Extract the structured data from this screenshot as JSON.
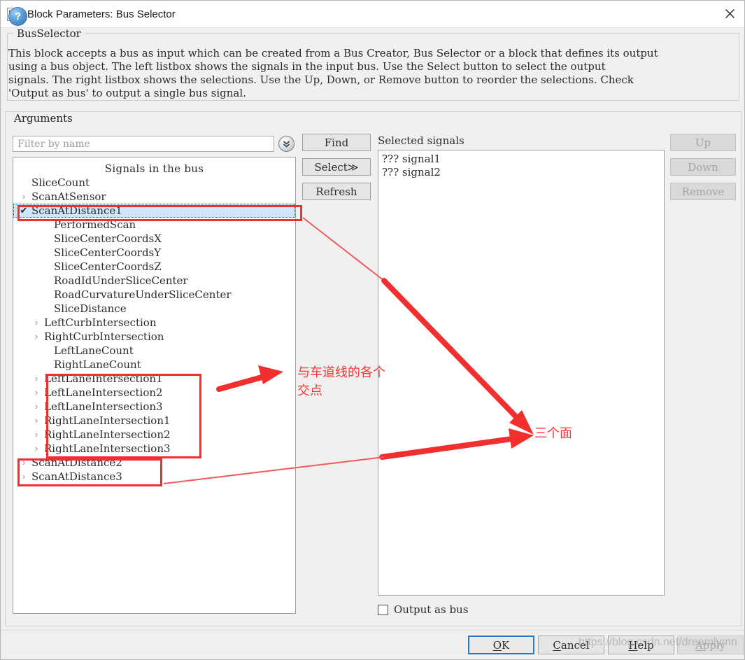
{
  "window": {
    "title": "Block Parameters: Bus Selector",
    "icon": "simulink-block-icon",
    "close_label": "✕"
  },
  "description": {
    "legend": "BusSelector",
    "text": "This block accepts a bus as input which can be created from a Bus Creator, Bus Selector or a block that defines its output\nusing a bus object. The left listbox shows the signals in the input bus. Use the Select button to select the output\nsignals. The right listbox shows the selections. Use the Up, Down, or Remove button to reorder the selections. Check\n'Output as bus' to output a single bus signal."
  },
  "arguments": {
    "legend": "Arguments",
    "filter": {
      "value": "",
      "placeholder": "Filter by name",
      "dropdown_icon": "double-chevron-down-icon"
    },
    "list_header": "Signals in the bus",
    "tree": [
      {
        "label": "SliceCount",
        "level": 0,
        "twisty": "",
        "checked": false,
        "selected": false
      },
      {
        "label": "ScanAtSensor",
        "level": 0,
        "twisty": "›",
        "checked": false,
        "selected": false
      },
      {
        "label": "ScanAtDistance1",
        "level": 0,
        "twisty": "",
        "checked": true,
        "selected": true
      },
      {
        "label": "PerformedScan",
        "level": 1,
        "twisty": "",
        "checked": false,
        "selected": false
      },
      {
        "label": "SliceCenterCoordsX",
        "level": 1,
        "twisty": "",
        "checked": false,
        "selected": false
      },
      {
        "label": "SliceCenterCoordsY",
        "level": 1,
        "twisty": "",
        "checked": false,
        "selected": false
      },
      {
        "label": "SliceCenterCoordsZ",
        "level": 1,
        "twisty": "",
        "checked": false,
        "selected": false
      },
      {
        "label": "RoadIdUnderSliceCenter",
        "level": 1,
        "twisty": "",
        "checked": false,
        "selected": false
      },
      {
        "label": "RoadCurvatureUnderSliceCenter",
        "level": 1,
        "twisty": "",
        "checked": false,
        "selected": false
      },
      {
        "label": "SliceDistance",
        "level": 1,
        "twisty": "",
        "checked": false,
        "selected": false
      },
      {
        "label": "LeftCurbIntersection",
        "level": 2,
        "twisty": "›",
        "checked": false,
        "selected": false
      },
      {
        "label": "RightCurbIntersection",
        "level": 2,
        "twisty": "›",
        "checked": false,
        "selected": false
      },
      {
        "label": "LeftLaneCount",
        "level": 1,
        "twisty": "",
        "checked": false,
        "selected": false
      },
      {
        "label": "RightLaneCount",
        "level": 1,
        "twisty": "",
        "checked": false,
        "selected": false
      },
      {
        "label": "LeftLaneIntersection1",
        "level": 2,
        "twisty": "›",
        "checked": false,
        "selected": false
      },
      {
        "label": "LeftLaneIntersection2",
        "level": 2,
        "twisty": "›",
        "checked": false,
        "selected": false
      },
      {
        "label": "LeftLaneIntersection3",
        "level": 2,
        "twisty": "›",
        "checked": false,
        "selected": false
      },
      {
        "label": "RightLaneIntersection1",
        "level": 2,
        "twisty": "›",
        "checked": false,
        "selected": false
      },
      {
        "label": "RightLaneIntersection2",
        "level": 2,
        "twisty": "›",
        "checked": false,
        "selected": false
      },
      {
        "label": "RightLaneIntersection3",
        "level": 2,
        "twisty": "›",
        "checked": false,
        "selected": false
      },
      {
        "label": "ScanAtDistance2",
        "level": 0,
        "twisty": "›",
        "checked": false,
        "selected": false
      },
      {
        "label": "ScanAtDistance3",
        "level": 0,
        "twisty": "›",
        "checked": false,
        "selected": false
      }
    ],
    "buttons": {
      "find": "Find",
      "select": "Select≫",
      "refresh": "Refresh"
    },
    "selected_signals": {
      "label": "Selected signals",
      "items": [
        "??? signal1",
        "??? signal2"
      ]
    },
    "order_buttons": {
      "up": "Up",
      "down": "Down",
      "remove": "Remove"
    },
    "output_as_bus": {
      "label": "Output as bus",
      "checked": false
    }
  },
  "footer": {
    "help_icon": "?",
    "ok": "OK",
    "cancel": "Cancel",
    "help": "Help",
    "apply": "Apply"
  },
  "watermark": {
    "text": "https://blog.csdn.net/dreamlymn"
  },
  "annotations": {
    "note_lane": "与车道线的各个\n交点",
    "note_faces": "三个面",
    "accent_color": "#f22f2f"
  }
}
